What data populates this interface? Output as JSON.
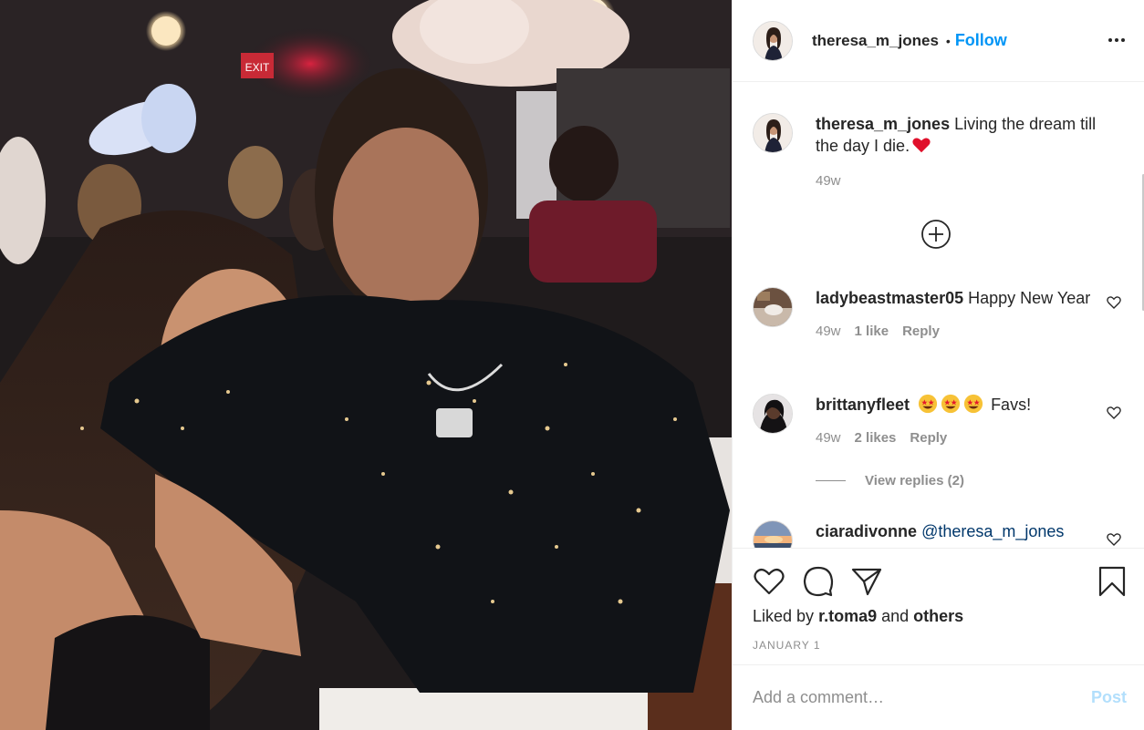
{
  "post": {
    "author": "theresa_m_jones",
    "follow_label": "Follow",
    "separator": "•",
    "caption": {
      "username": "theresa_m_jones",
      "text": "Living the dream till the day I die.",
      "emoji": "red-heart",
      "age": "49w"
    }
  },
  "comments": [
    {
      "username": "ladybeastmaster05",
      "text": "Happy New Year",
      "age": "49w",
      "likes": "1 like",
      "reply_label": "Reply"
    },
    {
      "username": "brittanyfleet",
      "text": "Favs!",
      "emojis": [
        "star-struck",
        "star-struck",
        "star-struck"
      ],
      "age": "49w",
      "likes": "2 likes",
      "reply_label": "Reply"
    },
    {
      "username": "ciaradivonne",
      "mention": "@theresa_m_jones"
    }
  ],
  "view_replies": "View replies (2)",
  "likes": {
    "prefix": "Liked by",
    "user": "r.toma9",
    "joiner": "and",
    "others": "others"
  },
  "date": "JANUARY 1",
  "add_comment": {
    "placeholder": "Add a comment…",
    "post_label": "Post"
  },
  "colors": {
    "accent": "#0095f6",
    "post_disabled": "#b2dffc",
    "muted": "#8e8e8e"
  }
}
